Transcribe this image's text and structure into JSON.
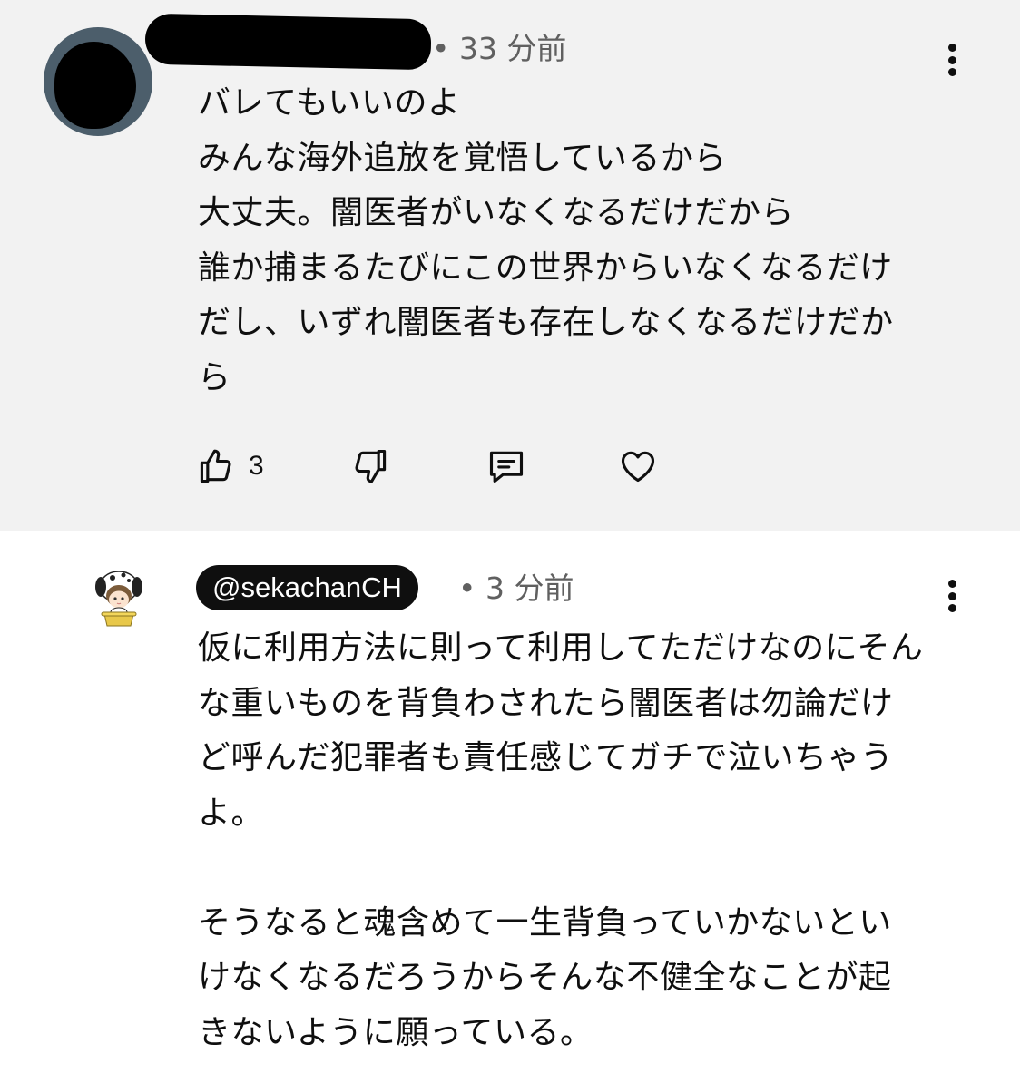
{
  "comments": [
    {
      "author_redacted": true,
      "timestamp": "• 33 分前",
      "text": "バレてもいいのよ\nみんな海外追放を覚悟しているから\n大丈夫。闇医者がいなくなるだけだから\n誰か捕まるたびにこの世界からいなくなるだけだし、いずれ闇医者も存在しなくなるだけだから",
      "like_count": "3",
      "icons": [
        "thumb-up-icon",
        "thumb-down-icon",
        "reply-icon",
        "heart-icon",
        "more-vert-icon"
      ]
    },
    {
      "author_handle": "@sekachanCH",
      "timestamp": "• 3 分前",
      "text": "仮に利用方法に則って利用してただけなのにそんな重いものを背負わされたら闇医者は勿論だけど呼んだ犯罪者も責任感じてガチで泣いちゃうよ。\n\nそうなると魂含めて一生背負っていかないといけなくなるだろうからそんな不健全なことが起きないように願っている。",
      "icons": [
        "more-vert-icon"
      ]
    }
  ],
  "colors": {
    "highlighted_bg": "#f2f2f2",
    "avatar_bg": "#4c5e6b",
    "meta_text": "#606060",
    "chip_bg": "#0f0f0f"
  }
}
